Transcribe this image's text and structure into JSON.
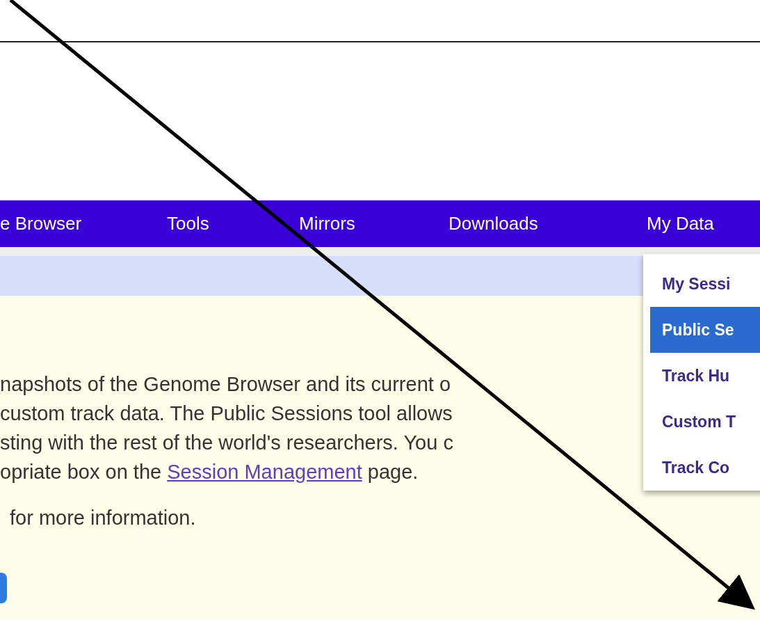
{
  "nav": {
    "items": [
      "e Browser",
      "Tools",
      "Mirrors",
      "Downloads",
      "My Data"
    ]
  },
  "menu": {
    "items": [
      {
        "label": "My Sessi",
        "selected": false
      },
      {
        "label": "Public Se",
        "selected": true
      },
      {
        "label": "Track Hu",
        "selected": false
      },
      {
        "label": "Custom T",
        "selected": false
      },
      {
        "label": "Track Co",
        "selected": false
      }
    ]
  },
  "body": {
    "lines": [
      "napshots of the Genome Browser and its current o",
      "custom track data. The Public Sessions tool allows",
      "sting with the rest of the world's researchers. You c"
    ],
    "link_line": {
      "before": "opriate box on the ",
      "link": "Session Management",
      "after": " page."
    },
    "more_info": "for more information."
  }
}
